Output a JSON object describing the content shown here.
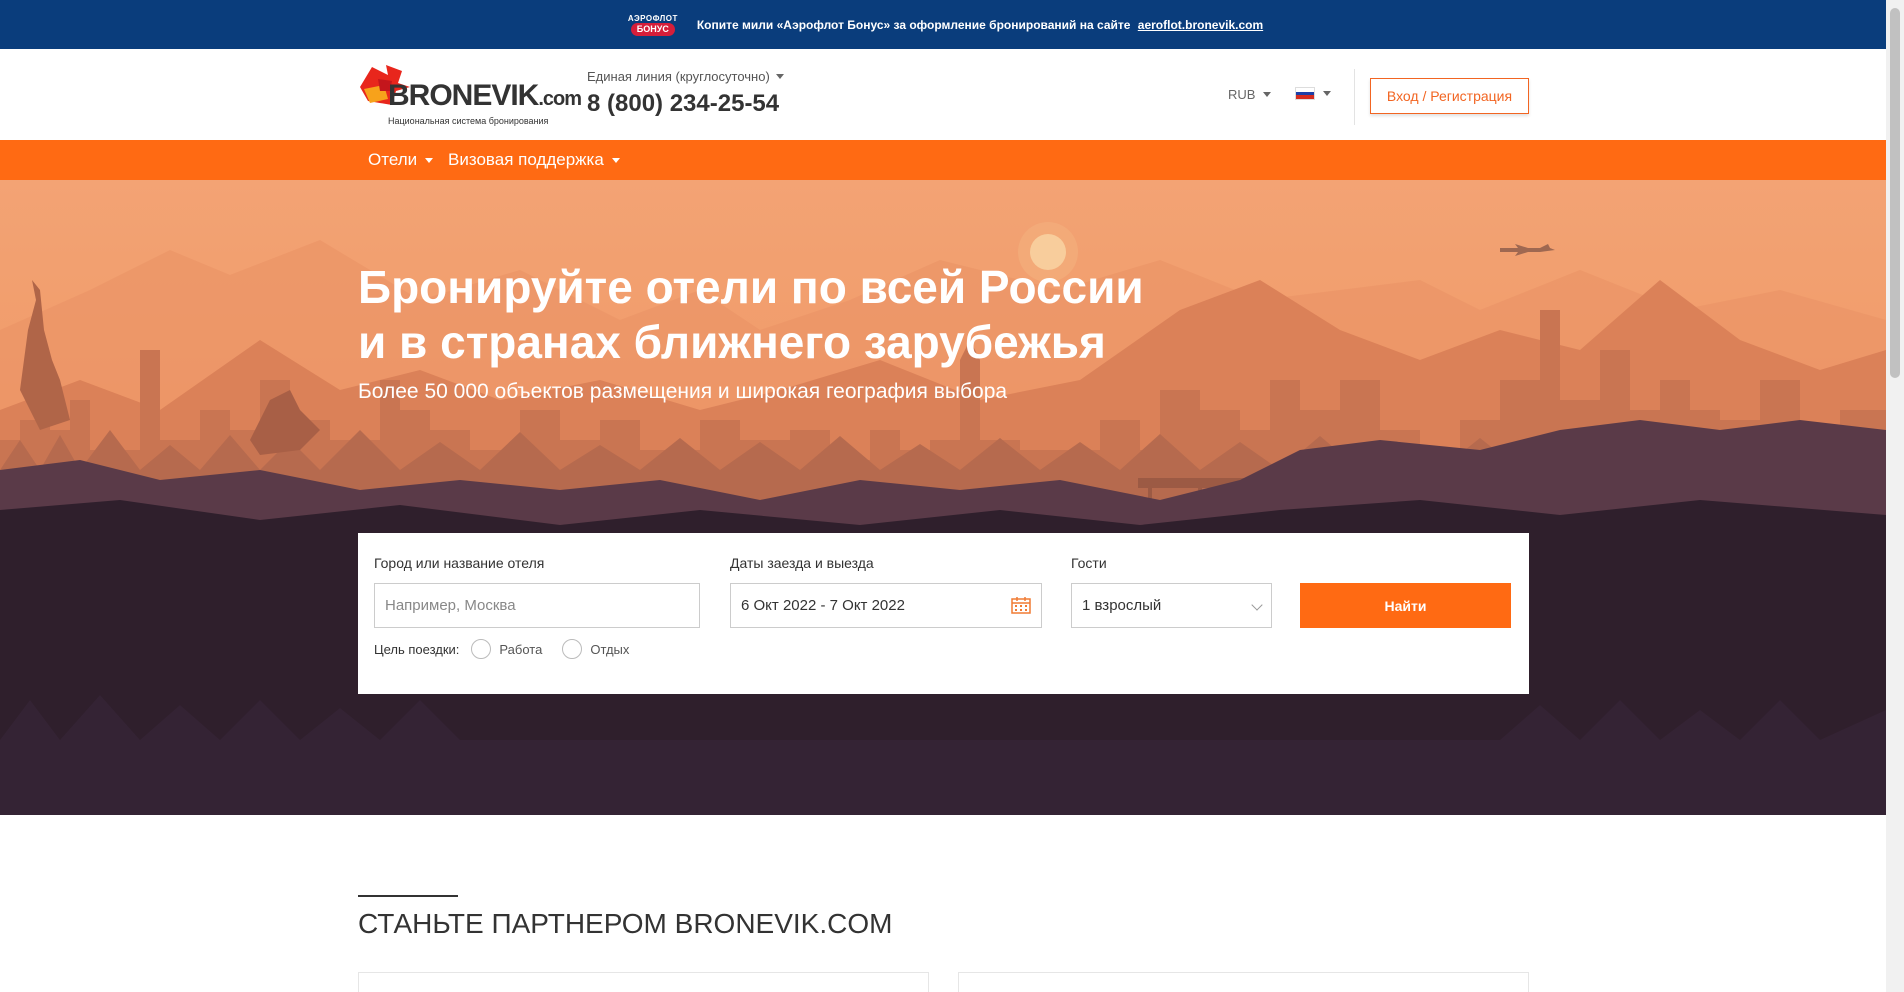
{
  "promo": {
    "logo_line1": "АЭРОФЛОТ",
    "logo_line2": "БОНУС",
    "text": "Копите мили «Аэрофлот Бонус» за оформление бронирований на сайте",
    "link": "aeroflot.bronevik.com"
  },
  "header": {
    "logo_word": "BRONEVIK",
    "logo_dotcom": ".com",
    "logo_tagline": "Национальная система бронирования",
    "phone_label": "Единая линия (круглосуточно)",
    "phone_number": "8 (800) 234-25-54",
    "currency": "RUB",
    "language_flag": "russia-flag-icon",
    "login_label": "Вход / Регистрация"
  },
  "nav": {
    "items": [
      {
        "label": "Отели"
      },
      {
        "label": "Визовая поддержка"
      }
    ]
  },
  "hero": {
    "title_line1": "Бронируйте отели по всей России",
    "title_line2": "и в странах ближнего зарубежья",
    "subtitle": "Более 50 000 объектов размещения и широкая география выбора"
  },
  "search": {
    "city_label": "Город или название отеля",
    "city_placeholder": "Например, Москва",
    "dates_label": "Даты заезда и выезда",
    "dates_value": "6 Окт 2022 - 7 Окт 2022",
    "guests_label": "Гости",
    "guests_value": "1 взрослый",
    "find_label": "Найти",
    "purpose_label": "Цель поездки:",
    "purpose_options": [
      {
        "label": "Работа"
      },
      {
        "label": "Отдых"
      }
    ]
  },
  "partner": {
    "title": "СТАНЬТЕ ПАРТНЕРОМ BRONEVIK.COM"
  },
  "colors": {
    "brand_orange": "#ff6a13",
    "promo_blue": "#0a3d7c",
    "hero_dark": "#2f1f2c"
  }
}
